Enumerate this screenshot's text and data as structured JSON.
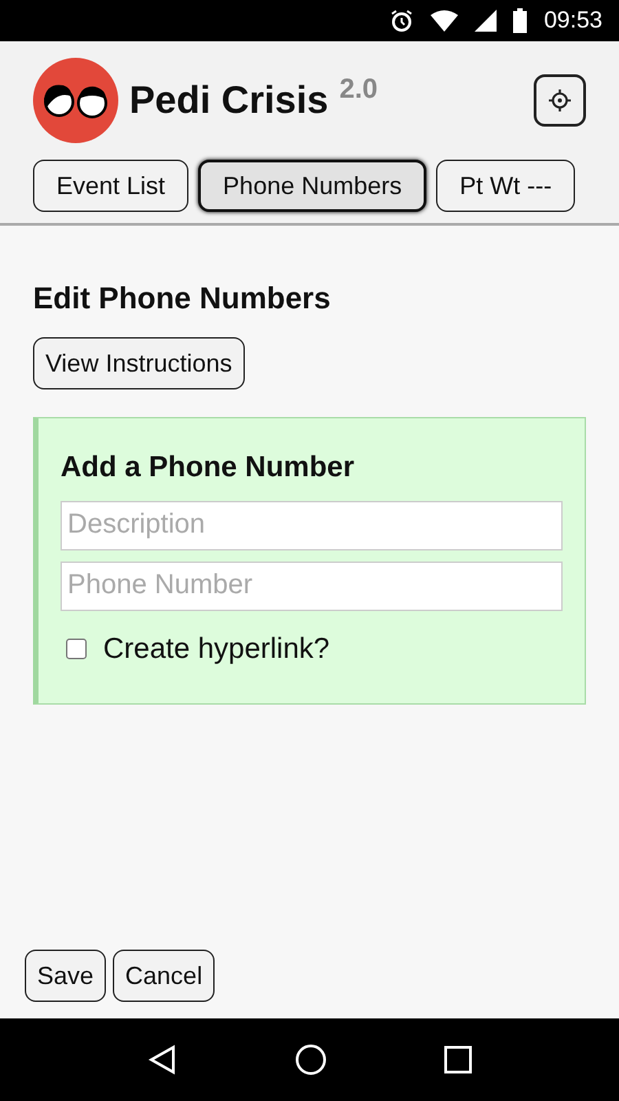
{
  "status_bar": {
    "time": "09:53"
  },
  "header": {
    "title": "Pedi Crisis",
    "version": "2.0"
  },
  "tabs": [
    {
      "label": "Event List",
      "selected": false
    },
    {
      "label": "Phone Numbers",
      "selected": true
    },
    {
      "label": "Pt Wt ---",
      "selected": false
    }
  ],
  "page": {
    "title": "Edit Phone Numbers",
    "instructions_button": "View Instructions"
  },
  "form": {
    "title": "Add a Phone Number",
    "fields": [
      {
        "placeholder": "Description"
      },
      {
        "placeholder": "Phone Number"
      }
    ],
    "checkbox": {
      "label": "Create hyperlink?",
      "checked": false
    }
  },
  "buttons": [
    "Save",
    "Cancel"
  ]
}
